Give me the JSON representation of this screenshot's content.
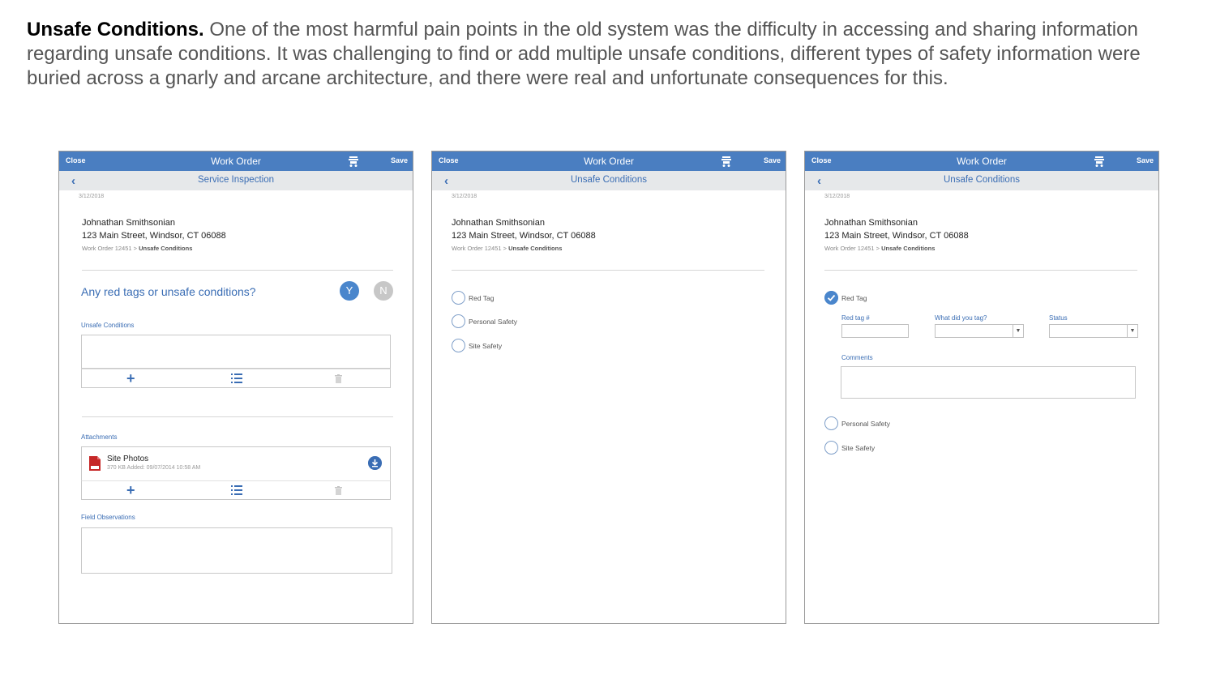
{
  "intro": {
    "lead": "Unsafe Conditions.",
    "body": " One of the most harmful pain points in the old system was the difficulty in accessing and sharing information regarding unsafe conditions. It was challenging to find or add multiple unsafe conditions, different types of safety information were buried across a gnarly and arcane architecture, and there were real and unfortunate consequences for this."
  },
  "colors": {
    "brand_blue": "#4a7ec1",
    "link_blue": "#3a6db4",
    "subbar_bg": "#e6e8ea"
  },
  "screens": [
    {
      "topbar": {
        "close": "Close",
        "title": "Work Order",
        "save": "Save",
        "cart_icon": "cart-icon"
      },
      "subbar": {
        "back_icon": "chevron-left-icon",
        "back": "‹",
        "title": "Service Inspection"
      },
      "date": "3/12/2018",
      "customer": {
        "name": "Johnathan Smithsonian",
        "address": "123 Main Street, Windsor, CT 06088"
      },
      "breadcrumb": {
        "parent": "Work Order 12451",
        "sep": ">",
        "current": "Unsafe Conditions"
      },
      "question": "Any red tags or unsafe conditions?",
      "yes": "Y",
      "no": "N",
      "unsafe_label": "Unsafe Conditions",
      "attachments_label": "Attachments",
      "attachment": {
        "name": "Site Photos",
        "meta": "370 KB Added: 09/07/2014  10:58 AM"
      },
      "field_observations_label": "Field Observations"
    },
    {
      "topbar": {
        "close": "Close",
        "title": "Work Order",
        "save": "Save"
      },
      "subbar": {
        "back": "‹",
        "title": "Unsafe Conditions"
      },
      "date": "3/12/2018",
      "customer": {
        "name": "Johnathan Smithsonian",
        "address": "123 Main Street, Windsor, CT 06088"
      },
      "breadcrumb": {
        "parent": "Work Order 12451",
        "sep": ">",
        "current": "Unsafe Conditions"
      },
      "options": [
        {
          "label": "Red Tag",
          "checked": false
        },
        {
          "label": "Personal Safety",
          "checked": false
        },
        {
          "label": "Site Safety",
          "checked": false
        }
      ]
    },
    {
      "topbar": {
        "close": "Close",
        "title": "Work Order",
        "save": "Save"
      },
      "subbar": {
        "back": "‹",
        "title": "Unsafe Conditions"
      },
      "date": "3/12/2018",
      "customer": {
        "name": "Johnathan Smithsonian",
        "address": "123 Main Street, Windsor, CT 06088"
      },
      "breadcrumb": {
        "parent": "Work Order 12451",
        "sep": ">",
        "current": "Unsafe Conditions"
      },
      "options": [
        {
          "label": "Red Tag",
          "checked": true
        },
        {
          "label": "Personal Safety",
          "checked": false
        },
        {
          "label": "Site Safety",
          "checked": false
        }
      ],
      "red_tag_fields": {
        "red_tag_number": "Red tag #",
        "what_tagged": "What did you tag?",
        "status": "Status",
        "comments": "Comments",
        "select_arrow": "▼"
      }
    }
  ]
}
